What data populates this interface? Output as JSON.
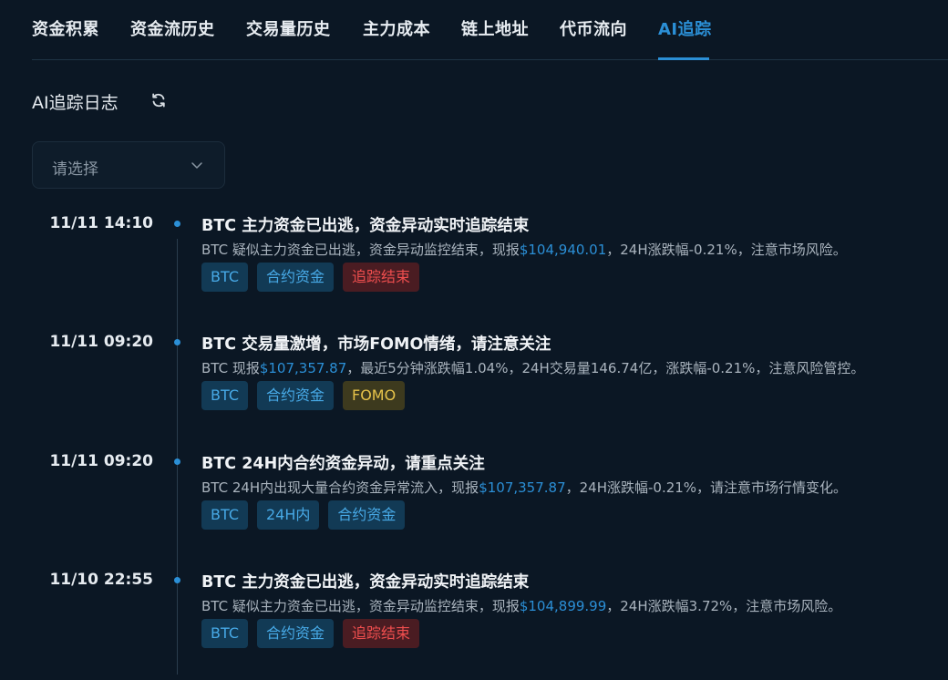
{
  "tabs": [
    {
      "label": "资金积累",
      "active": false
    },
    {
      "label": "资金流历史",
      "active": false
    },
    {
      "label": "交易量历史",
      "active": false
    },
    {
      "label": "主力成本",
      "active": false
    },
    {
      "label": "链上地址",
      "active": false
    },
    {
      "label": "代币流向",
      "active": false
    },
    {
      "label": "AI追踪",
      "active": true
    }
  ],
  "log": {
    "title": "AI追踪日志",
    "refresh_icon": "refresh-icon",
    "select_placeholder": "请选择"
  },
  "entries": [
    {
      "time": "11/11 14:10",
      "title": "BTC 主力资金已出逃，资金异动实时追踪结束",
      "desc_before": "BTC 疑似主力资金已出逃，资金异动监控结束，现报",
      "price": "$104,940.01",
      "desc_after": "，24H涨跌幅-0.21%，注意市场风险。",
      "tags": [
        {
          "label": "BTC",
          "color": "blue"
        },
        {
          "label": "合约资金",
          "color": "blue"
        },
        {
          "label": "追踪结束",
          "color": "red"
        }
      ]
    },
    {
      "time": "11/11 09:20",
      "title": "BTC 交易量激增，市场FOMO情绪，请注意关注",
      "desc_before": "BTC 现报",
      "price": "$107,357.87",
      "desc_after": "，最近5分钟涨跌幅1.04%，24H交易量146.74亿，涨跌幅-0.21%，注意风险管控。",
      "tags": [
        {
          "label": "BTC",
          "color": "blue"
        },
        {
          "label": "合约资金",
          "color": "blue"
        },
        {
          "label": "FOMO",
          "color": "yellow"
        }
      ]
    },
    {
      "time": "11/11 09:20",
      "title": "BTC 24H内合约资金异动，请重点关注",
      "desc_before": "BTC 24H内出现大量合约资金异常流入，现报",
      "price": "$107,357.87",
      "desc_after": "，24H涨跌幅-0.21%，请注意市场行情变化。",
      "tags": [
        {
          "label": "BTC",
          "color": "blue"
        },
        {
          "label": "24H内",
          "color": "blue"
        },
        {
          "label": "合约资金",
          "color": "blue"
        }
      ]
    },
    {
      "time": "11/10 22:55",
      "title": "BTC 主力资金已出逃，资金异动实时追踪结束",
      "desc_before": "BTC 疑似主力资金已出逃，资金异动监控结束，现报",
      "price": "$104,899.99",
      "desc_after": "，24H涨跌幅3.72%，注意市场风险。",
      "tags": [
        {
          "label": "BTC",
          "color": "blue"
        },
        {
          "label": "合约资金",
          "color": "blue"
        },
        {
          "label": "追踪结束",
          "color": "red"
        }
      ]
    }
  ],
  "colors": {
    "accent": "#2b8fd6",
    "background": "#0b1724",
    "tag_blue": "#47a9e6",
    "tag_red": "#ef4e4e",
    "tag_yellow": "#e6c34a"
  }
}
